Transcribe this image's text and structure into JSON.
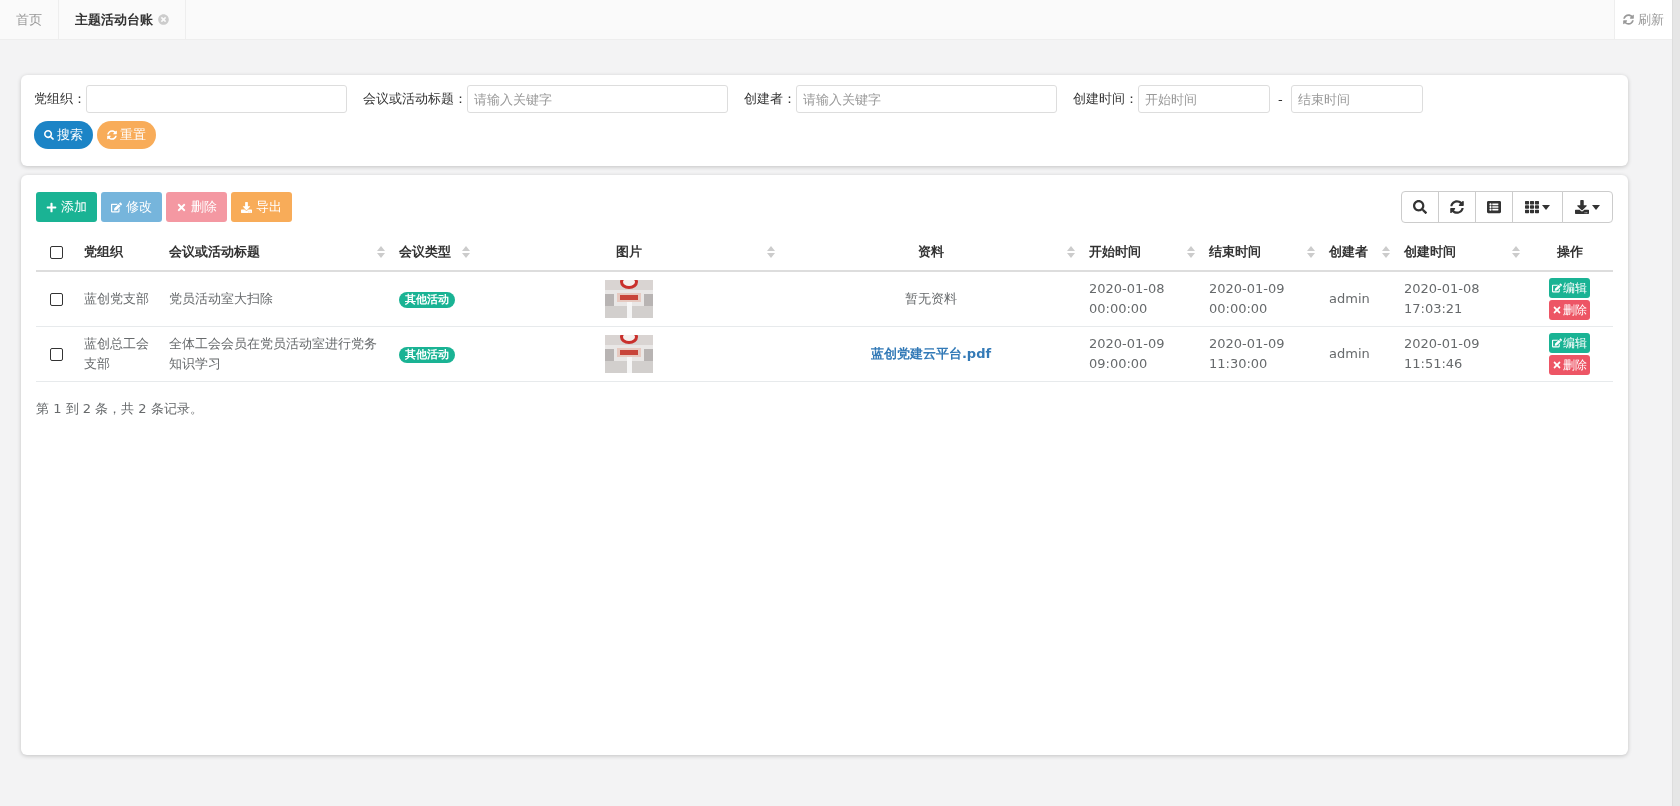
{
  "tabs": [
    {
      "label": "首页",
      "selected": false,
      "closable": false
    },
    {
      "label": "主题活动台账",
      "selected": true,
      "closable": true
    }
  ],
  "refresh": "刷新",
  "search": {
    "fields": [
      {
        "label": "党组织：",
        "kind": "text"
      },
      {
        "label": "会议或活动标题：",
        "kind": "text",
        "placeholder": "请输入关键字"
      },
      {
        "label": "创建者：",
        "kind": "text",
        "placeholder": "请输入关键字"
      },
      {
        "label": "创建时间：",
        "kind": "range",
        "placeholder": "开始时间",
        "placeholder_end": "结束时间",
        "separator": "-"
      }
    ],
    "buttons": [
      {
        "label": "搜索",
        "kind": "search"
      },
      {
        "label": "重置",
        "kind": "reset"
      }
    ]
  },
  "toolbar": [
    {
      "label": "添加",
      "kind": "add",
      "disabled": false
    },
    {
      "label": "修改",
      "kind": "edit",
      "disabled": true
    },
    {
      "label": "删除",
      "kind": "delete",
      "disabled": true
    },
    {
      "label": "导出",
      "kind": "export",
      "disabled": false
    }
  ],
  "tools": [
    {
      "kind": "search",
      "caret": false
    },
    {
      "kind": "refresh",
      "caret": false
    },
    {
      "kind": "view",
      "caret": false
    },
    {
      "kind": "columns",
      "caret": true
    },
    {
      "kind": "download",
      "caret": true
    }
  ],
  "table": {
    "select_all": {
      "checked": false
    },
    "columns": [
      {
        "label": "党组织",
        "sortable": false
      },
      {
        "label": "会议或活动标题",
        "sortable": true
      },
      {
        "label": "会议类型",
        "sortable": true
      },
      {
        "label": "图片",
        "sortable": true
      },
      {
        "label": "资料",
        "sortable": true
      },
      {
        "label": "开始时间",
        "sortable": true
      },
      {
        "label": "结束时间",
        "sortable": true
      },
      {
        "label": "创建者",
        "sortable": true
      },
      {
        "label": "创建时间",
        "sortable": true
      },
      {
        "label": "操作",
        "sortable": false
      }
    ],
    "rows": [
      {
        "checked": false,
        "org": "蓝创党支部",
        "title": "党员活动室大扫除",
        "type": "其他活动",
        "material": {
          "text": "暂无资料",
          "link": false
        },
        "start": [
          "2020-01-08",
          "00:00:00"
        ],
        "end": [
          "2020-01-09",
          "00:00:00"
        ],
        "creator": "admin",
        "created": [
          "2020-01-08",
          "17:03:21"
        ],
        "actions": [
          "编辑",
          "删除"
        ]
      },
      {
        "checked": false,
        "org": "蓝创总工会支部",
        "title": "全体工会会员在党员活动室进行党务知识学习",
        "type": "其他活动",
        "material": {
          "text": "蓝创党建云平台.pdf",
          "link": true
        },
        "start": [
          "2020-01-09",
          "09:00:00"
        ],
        "end": [
          "2020-01-09",
          "11:30:00"
        ],
        "creator": "admin",
        "created": [
          "2020-01-09",
          "11:51:46"
        ],
        "actions": [
          "编辑",
          "删除"
        ]
      }
    ]
  },
  "pagination": "第 1 到 2 条，共 2 条记录。"
}
